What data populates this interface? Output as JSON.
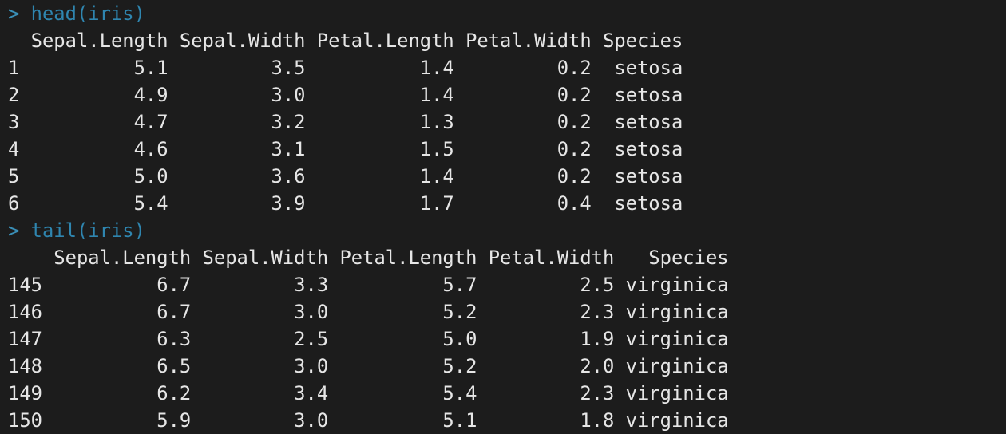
{
  "console": {
    "prompt_symbol": ">",
    "blocks": [
      {
        "command": "head(iris)",
        "header": "  Sepal.Length Sepal.Width Petal.Length Petal.Width Species",
        "rows": [
          "1          5.1         3.5          1.4         0.2  setosa",
          "2          4.9         3.0          1.4         0.2  setosa",
          "3          4.7         3.2          1.3         0.2  setosa",
          "4          4.6         3.1          1.5         0.2  setosa",
          "5          5.0         3.6          1.4         0.2  setosa",
          "6          5.4         3.9          1.7         0.4  setosa"
        ]
      },
      {
        "command": "tail(iris)",
        "header": "    Sepal.Length Sepal.Width Petal.Length Petal.Width   Species",
        "rows": [
          "145          6.7         3.3          5.7         2.5 virginica",
          "146          6.7         3.0          5.2         2.3 virginica",
          "147          6.3         2.5          5.0         1.9 virginica",
          "148          6.5         3.0          5.2         2.0 virginica",
          "149          6.2         3.4          5.4         2.3 virginica",
          "150          5.9         3.0          5.1         1.8 virginica"
        ]
      }
    ]
  },
  "colors": {
    "background": "#1c1c1c",
    "prompt": "#3a8fb7",
    "output": "#e6e6e6"
  }
}
